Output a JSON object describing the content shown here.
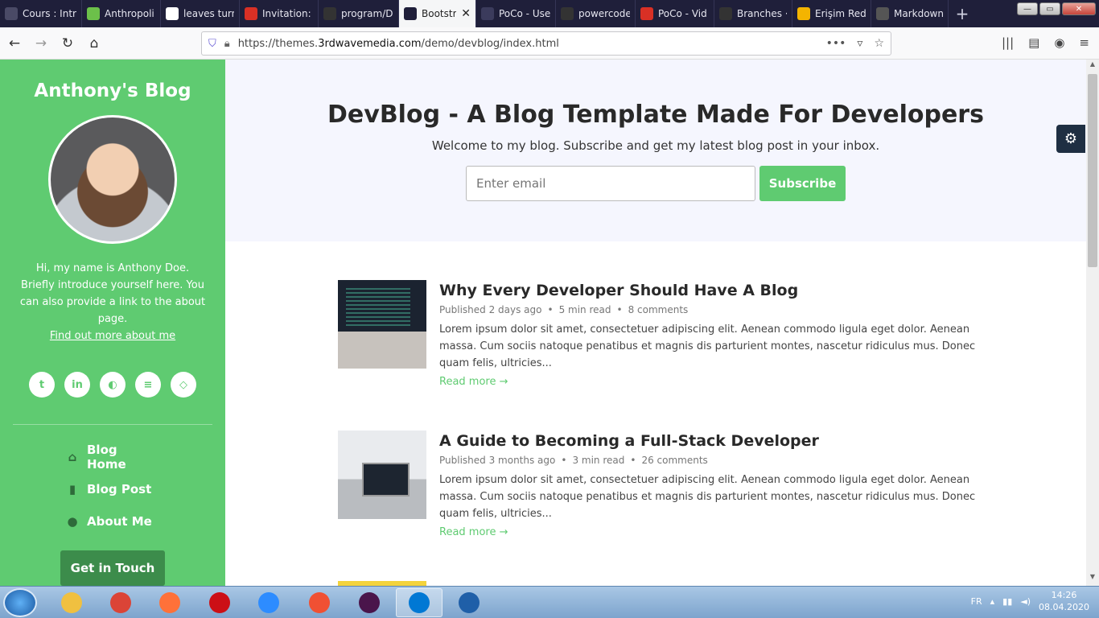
{
  "browser": {
    "tabs": [
      {
        "title": "Cours : Intr",
        "icon": "tab-icon-cours",
        "color": "#4a4a66"
      },
      {
        "title": "Anthropoli",
        "icon": "tab-icon-anthropoli",
        "color": "#6cc04a"
      },
      {
        "title": "leaves turn",
        "icon": "google-icon",
        "color": "#ffffff"
      },
      {
        "title": "Invitation:",
        "icon": "gmail-icon",
        "color": "#d93025"
      },
      {
        "title": "program/D",
        "icon": "github-icon",
        "color": "#333333"
      },
      {
        "title": "Bootstr",
        "icon": "heart-icon",
        "color": "#1f1f3a",
        "active": true
      },
      {
        "title": "PoCo - Useful l",
        "icon": "poco-icon",
        "color": "#3b3b5c"
      },
      {
        "title": "powercode",
        "icon": "github-icon",
        "color": "#333333"
      },
      {
        "title": "PoCo - Vid",
        "icon": "poco-video-icon",
        "color": "#d93025"
      },
      {
        "title": "Branches ·",
        "icon": "github-icon",
        "color": "#333333"
      },
      {
        "title": "Erişim Red",
        "icon": "google-drive-icon",
        "color": "#f4b400"
      },
      {
        "title": "Markdown",
        "icon": "markdown-icon",
        "color": "#555555"
      }
    ],
    "url_prefix": "https://themes.",
    "url_domain": "3rdwavemedia.com",
    "url_path": "/demo/devblog/index.html"
  },
  "sidebar": {
    "blog_name": "Anthony's Blog",
    "bio": "Hi, my name is Anthony Doe. Briefly introduce yourself here. You can also provide a link to the about page.",
    "about_link": "Find out more about me",
    "social": [
      {
        "name": "twitter-icon",
        "glyph": "t"
      },
      {
        "name": "linkedin-icon",
        "glyph": "in"
      },
      {
        "name": "github-icon",
        "glyph": "◐"
      },
      {
        "name": "stackoverflow-icon",
        "glyph": "≡"
      },
      {
        "name": "codepen-icon",
        "glyph": "◇"
      }
    ],
    "nav": [
      {
        "label": "Blog Home",
        "icon": "home-icon",
        "glyph": "⌂"
      },
      {
        "label": "Blog Post",
        "icon": "bookmark-icon",
        "glyph": "▮"
      },
      {
        "label": "About Me",
        "icon": "user-icon",
        "glyph": "●"
      }
    ],
    "cta": "Get in Touch"
  },
  "hero": {
    "title": "DevBlog - A Blog Template Made For Developers",
    "subtitle": "Welcome to my blog. Subscribe and get my latest blog post in your inbox.",
    "email_placeholder": "Enter email",
    "subscribe_label": "Subscribe"
  },
  "posts": [
    {
      "title": "Why Every Developer Should Have A Blog",
      "published": "Published 2 days ago",
      "read": "5 min read",
      "comments": "8 comments",
      "excerpt": "Lorem ipsum dolor sit amet, consectetuer adipiscing elit. Aenean commodo ligula eget dolor. Aenean massa. Cum sociis natoque penatibus et magnis dis parturient montes, nascetur ridiculus mus. Donec quam felis, ultricies...",
      "more": "Read more →"
    },
    {
      "title": "A Guide to Becoming a Full-Stack Developer",
      "published": "Published 3 months ago",
      "read": "3 min read",
      "comments": "26 comments",
      "excerpt": "Lorem ipsum dolor sit amet, consectetuer adipiscing elit. Aenean commodo ligula eget dolor. Aenean massa. Cum sociis natoque penatibus et magnis dis parturient montes, nascetur ridiculus mus. Donec quam felis, ultricies...",
      "more": "Read more →"
    }
  ],
  "meta_separator": "•",
  "colors": {
    "accent": "#5fcb71",
    "accent_dark": "#3c8c4b",
    "hero_bg": "#f5f6fe"
  },
  "taskbar": {
    "apps": [
      "windows-explorer-icon",
      "chrome-icon",
      "firefox-icon",
      "opera-icon",
      "zoom-icon",
      "git-icon",
      "slack-icon",
      "vscode-icon",
      "app-icon"
    ],
    "app_colors": [
      "#f0c040",
      "#db4437",
      "#ff7139",
      "#cc0f16",
      "#2d8cff",
      "#f05033",
      "#4a154b",
      "#0078d4",
      "#1f5fa8"
    ],
    "language": "FR",
    "time": "14:26",
    "date": "08.04.2020"
  }
}
